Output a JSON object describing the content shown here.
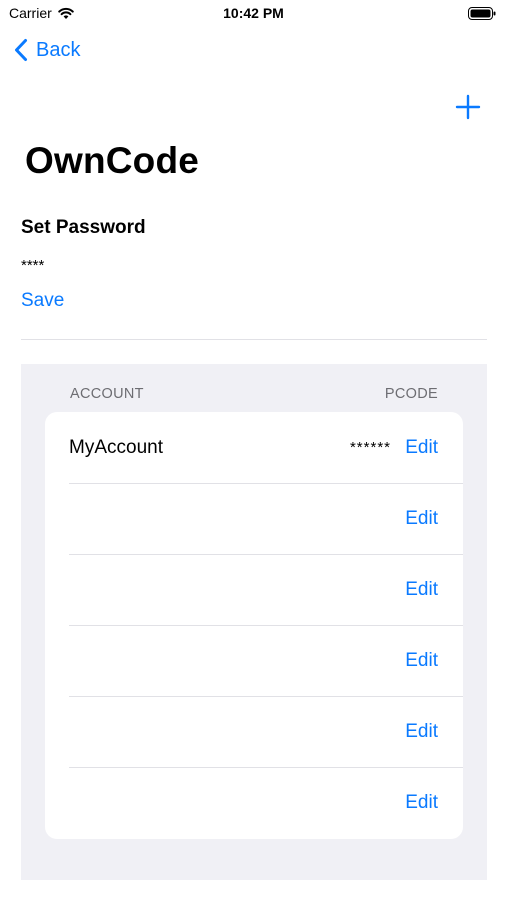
{
  "status_bar": {
    "carrier": "Carrier",
    "time": "10:42 PM",
    "wifi_icon": "wifi-icon",
    "battery_icon": "battery-icon"
  },
  "nav": {
    "back_label": "Back",
    "back_icon": "chevron-left-icon",
    "add_icon": "plus-icon"
  },
  "page": {
    "title": "OwnCode",
    "section_label": "Set Password",
    "password_value": "****",
    "save_label": "Save"
  },
  "table": {
    "headers": {
      "account": "ACCOUNT",
      "pcode": "PCODE"
    },
    "rows": [
      {
        "account": "MyAccount",
        "code": "******",
        "edit": "Edit"
      },
      {
        "account": "",
        "code": "",
        "edit": "Edit"
      },
      {
        "account": "",
        "code": "",
        "edit": "Edit"
      },
      {
        "account": "",
        "code": "",
        "edit": "Edit"
      },
      {
        "account": "",
        "code": "",
        "edit": "Edit"
      },
      {
        "account": "",
        "code": "",
        "edit": "Edit"
      }
    ]
  },
  "colors": {
    "accent": "#0a7aff",
    "grouped_background": "#f0f0f5",
    "secondary_text": "#6d6d72",
    "separator": "#e1e1e6"
  }
}
